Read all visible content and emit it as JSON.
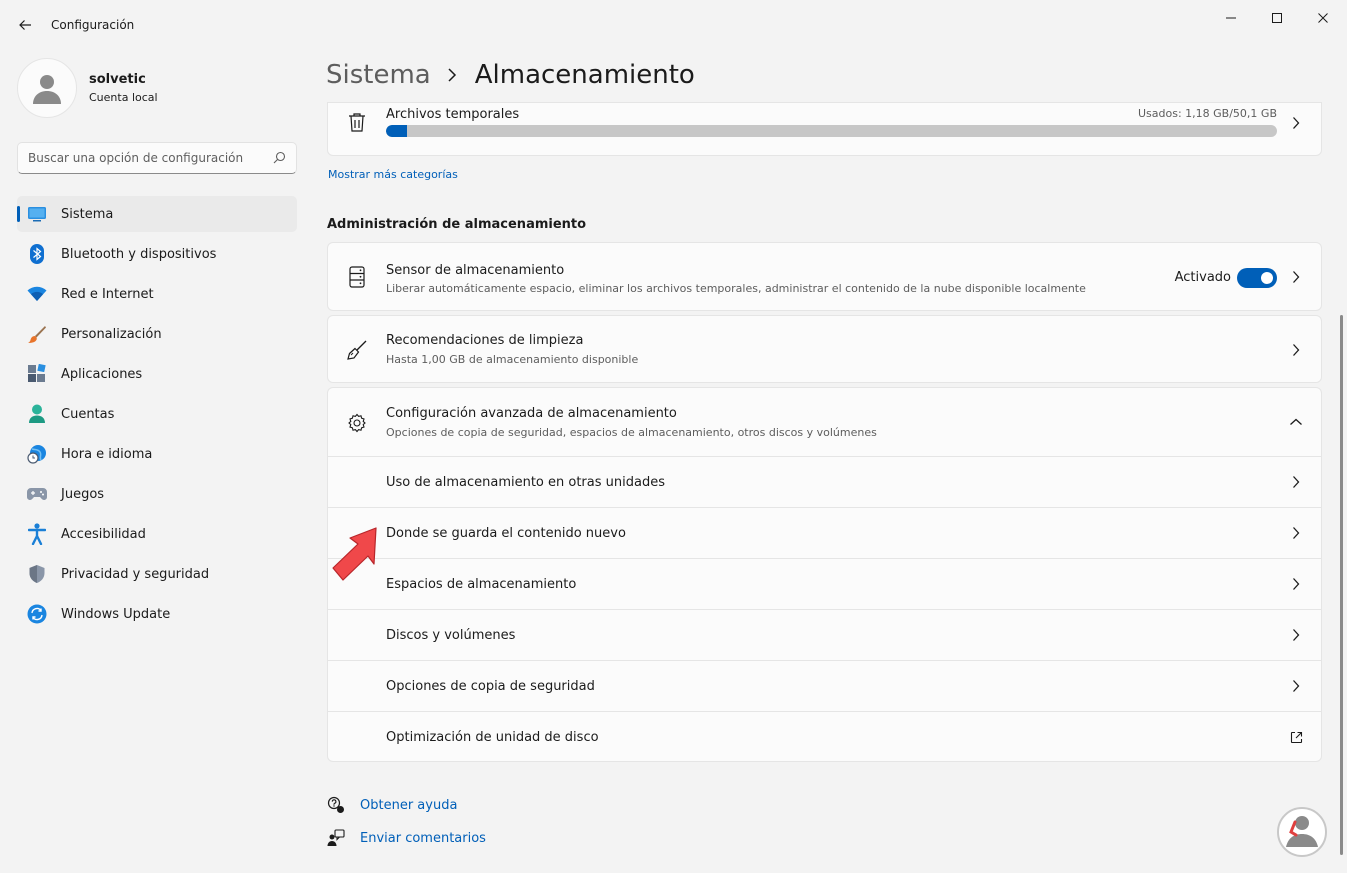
{
  "window": {
    "title": "Configuración"
  },
  "profile": {
    "name": "solvetic",
    "account": "Cuenta local"
  },
  "search": {
    "placeholder": "Buscar una opción de configuración"
  },
  "nav": {
    "items": [
      {
        "label": "Sistema",
        "icon": "monitor-icon",
        "active": true
      },
      {
        "label": "Bluetooth y dispositivos",
        "icon": "bluetooth-icon"
      },
      {
        "label": "Red e Internet",
        "icon": "wifi-icon"
      },
      {
        "label": "Personalización",
        "icon": "brush-icon"
      },
      {
        "label": "Aplicaciones",
        "icon": "apps-icon"
      },
      {
        "label": "Cuentas",
        "icon": "person-icon"
      },
      {
        "label": "Hora e idioma",
        "icon": "globe-clock-icon"
      },
      {
        "label": "Juegos",
        "icon": "gamepad-icon"
      },
      {
        "label": "Accesibilidad",
        "icon": "accessibility-icon"
      },
      {
        "label": "Privacidad y seguridad",
        "icon": "shield-icon"
      },
      {
        "label": "Windows Update",
        "icon": "update-icon"
      }
    ]
  },
  "breadcrumb": {
    "parent": "Sistema",
    "current": "Almacenamiento"
  },
  "temp_files": {
    "title": "Archivos temporales",
    "usage": "Usados: 1,18 GB/50,1 GB",
    "fill_fraction": 0.0236
  },
  "more_categories": "Mostrar más categorías",
  "management": {
    "section_title": "Administración de almacenamiento",
    "sensor": {
      "title": "Sensor de almacenamiento",
      "subtitle": "Liberar automáticamente espacio, eliminar los archivos temporales, administrar el contenido de la nube disponible localmente",
      "state_label": "Activado",
      "enabled": true
    },
    "cleanup": {
      "title": "Recomendaciones de limpieza",
      "subtitle": "Hasta 1,00 GB de almacenamiento disponible"
    },
    "advanced": {
      "title": "Configuración avanzada de almacenamiento",
      "subtitle": "Opciones de copia de seguridad, espacios de almacenamiento, otros discos y volúmenes",
      "items": [
        "Uso de almacenamiento en otras unidades",
        "Donde se guarda el contenido nuevo",
        "Espacios de almacenamiento",
        "Discos y volúmenes",
        "Opciones de copia de seguridad",
        "Optimización de unidad de disco"
      ]
    }
  },
  "footer": {
    "help": "Obtener ayuda",
    "feedback": "Enviar comentarios"
  },
  "colors": {
    "accent": "#005fb8",
    "annotation_arrow": "#f0484a"
  }
}
